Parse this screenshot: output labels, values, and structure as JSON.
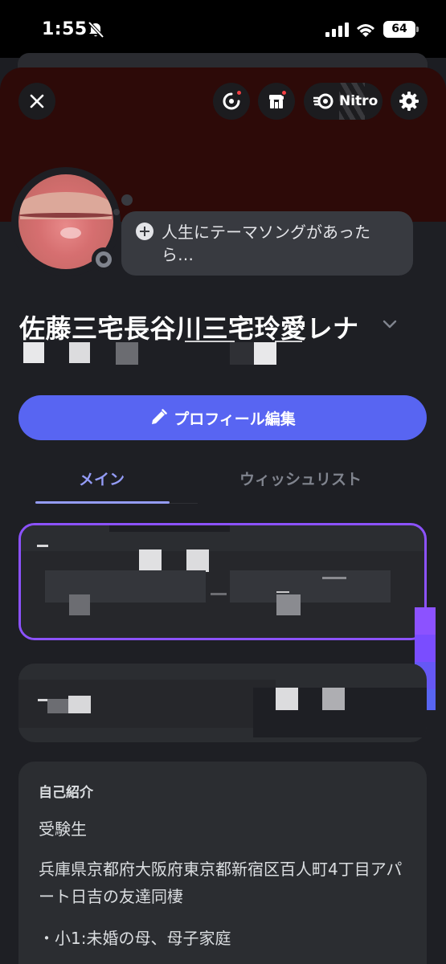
{
  "status_bar": {
    "time": "1:55",
    "battery": "64",
    "icons": [
      "bell-slash-icon",
      "signal-icon",
      "wifi-icon",
      "battery-icon"
    ]
  },
  "header": {
    "buttons": [
      "close-icon",
      "activity-icon",
      "shop-icon",
      "settings-icon"
    ],
    "nitro_label": "Nitro"
  },
  "profile": {
    "custom_status": "人生にテーマソングがあったら…",
    "display_name": "佐藤三宅長谷川三宅玲愛レナ",
    "presence": "offline"
  },
  "actions": {
    "edit_profile_label": "プロフィール編集"
  },
  "tabs": [
    {
      "label": "メイン",
      "active": true
    },
    {
      "label": "ウィッシュリスト",
      "active": false
    }
  ],
  "bio": {
    "title": "自己紹介",
    "lines": [
      "受験生",
      "兵庫県京都府大阪府東京都新宿区百人町4丁目アパート日吉の友達同棲",
      "・小1:未婚の母、母子家庭"
    ]
  },
  "colors": {
    "accent": "#5865f2",
    "tab_active": "#949cf7",
    "card_border": "#8c52ff",
    "banner": "#2d0a08",
    "notification": "#f23f43"
  }
}
